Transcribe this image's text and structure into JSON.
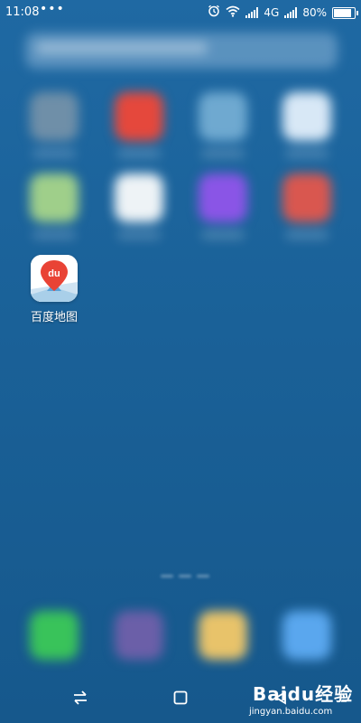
{
  "status_bar": {
    "time": "11:08",
    "more_indicator": "•••",
    "network": "4G",
    "battery_percent": "80%",
    "battery_level": 0.8
  },
  "home": {
    "focused_app": {
      "label": "百度地图",
      "icon": "baidu-maps-icon",
      "icon_text": "du",
      "accent": "#e94335"
    }
  },
  "watermark": {
    "logo_text": "Baidu经验",
    "url": "jingyan.baidu.com"
  },
  "colors": {
    "background": "#1a6198",
    "tile_red": "#e5483c",
    "tile_green": "#39c35a",
    "tile_purple": "#8a55e6"
  }
}
